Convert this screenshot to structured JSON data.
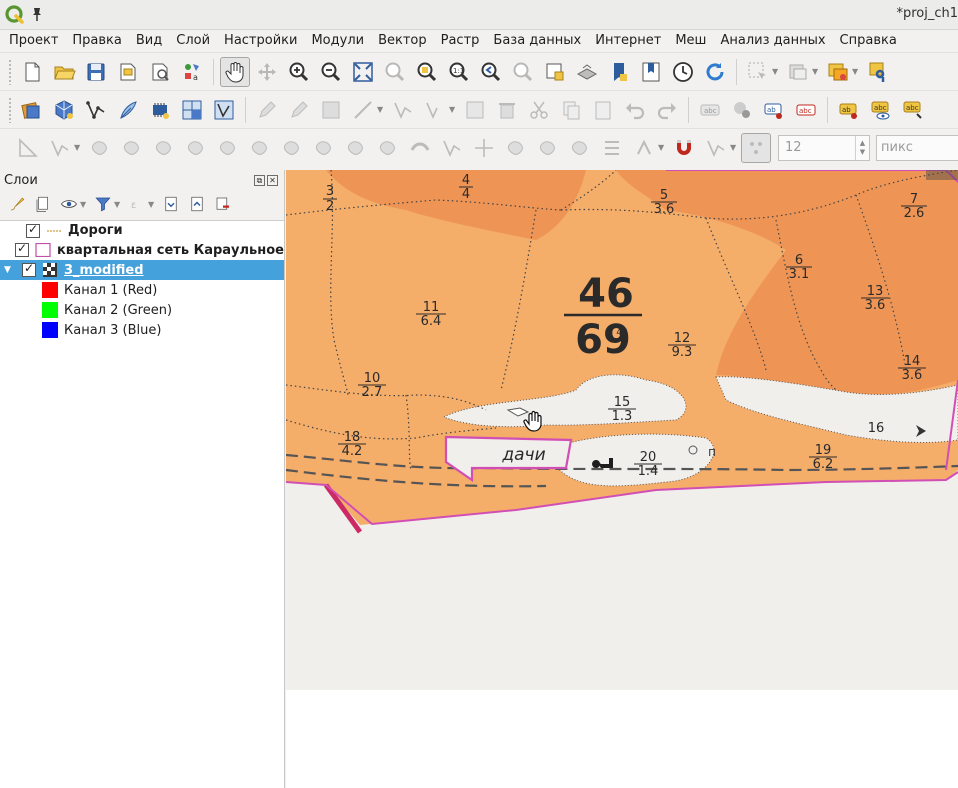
{
  "window": {
    "title": "*proj_ch1"
  },
  "menu": [
    "Проект",
    "Правка",
    "Вид",
    "Слой",
    "Настройки",
    "Модули",
    "Вектор",
    "Растр",
    "База данных",
    "Интернет",
    "Меш",
    "Анализ данных",
    "Справка"
  ],
  "digitizing": {
    "snap_tolerance": "12",
    "snap_units": "пикс"
  },
  "layers_panel": {
    "title": "Слои",
    "layers": [
      {
        "name": "Дороги",
        "checked": true,
        "style": "bold"
      },
      {
        "name": "квартальная сеть Караульное",
        "checked": true,
        "style": "bold"
      },
      {
        "name": "3_modified",
        "checked": true,
        "style": "underline",
        "selected": true
      }
    ],
    "bands": [
      {
        "name": "Канал 1 (Red)",
        "color": "#ff0000"
      },
      {
        "name": "Канал 2 (Green)",
        "color": "#00ff00"
      },
      {
        "name": "Канал 3 (Blue)",
        "color": "#0000ff"
      }
    ]
  },
  "map": {
    "quarter_number": "46",
    "quarter_area": "69",
    "dachi_label": "дачи",
    "parcels": [
      {
        "num": "3",
        "area": "2"
      },
      {
        "num": "4",
        "area": "4"
      },
      {
        "num": "5",
        "area": "3.6"
      },
      {
        "num": "7",
        "area": "2.6"
      },
      {
        "num": "6",
        "area": "3.1"
      },
      {
        "num": "13",
        "area": "3.6"
      },
      {
        "num": "11",
        "area": "6.4"
      },
      {
        "num": "12",
        "area": "9.3"
      },
      {
        "num": "14",
        "area": "3.6"
      },
      {
        "num": "10",
        "area": "2.7"
      },
      {
        "num": "15",
        "area": "1.3"
      },
      {
        "num": "18",
        "area": "4.2"
      },
      {
        "num": "20",
        "area": "1.4"
      },
      {
        "num": "19",
        "area": "6.2"
      }
    ],
    "small_numbers": [
      "16",
      "46",
      "П"
    ],
    "colors": {
      "orange_light": "#f5ad6a",
      "orange_dark": "#ee9556",
      "paper": "#f1efec",
      "boundary": "#d14fb4"
    }
  }
}
